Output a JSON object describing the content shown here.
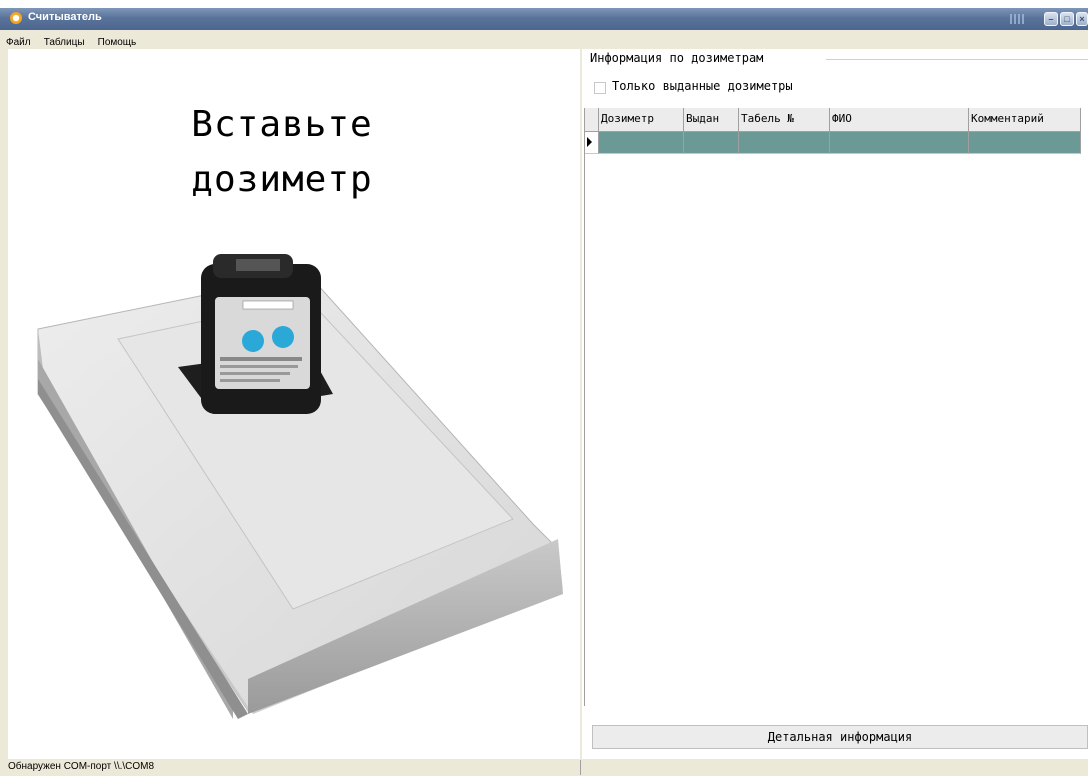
{
  "window": {
    "title": "Считыватель"
  },
  "menu": [
    "Файл",
    "Таблицы",
    "Помощь"
  ],
  "left": {
    "prompt_line1": "Вставьте",
    "prompt_line2": "дозиметр"
  },
  "right": {
    "group_title": "Информация по дозиметрам",
    "filter_label": "Только выданные дозиметры",
    "filter_checked": false,
    "columns": [
      "Дозиметр",
      "Выдан",
      "Табель №",
      "ФИО",
      "Комментарий"
    ],
    "rows": [
      [
        "",
        "",
        "",
        "",
        ""
      ]
    ],
    "detail_button": "Детальная информация"
  },
  "status": {
    "text": "Обнаружен COM-порт \\\\.\\COM8"
  },
  "colors": {
    "selected_row": "#6b9a96",
    "titlebar": "#5a739a"
  }
}
